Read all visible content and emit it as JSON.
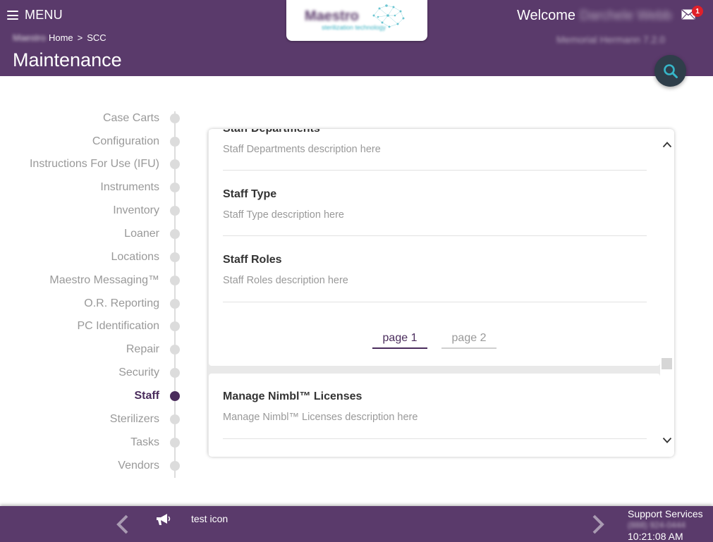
{
  "header": {
    "menu_label": "MENU",
    "breadcrumb": {
      "brand": "Maestro",
      "home": "Home",
      "separator": ">",
      "current": "SCC"
    },
    "page_title": "Maintenance",
    "logo": {
      "name": "Maestro",
      "tagline": "sterilization technology"
    },
    "welcome_label": "Welcome",
    "user_name": "Darchele Webb",
    "notification_count": "1",
    "facility": "Memorial Hermann 7.2.0"
  },
  "sidebar": {
    "items": [
      {
        "label": "Case Carts"
      },
      {
        "label": "Configuration"
      },
      {
        "label": "Instructions For Use (IFU)"
      },
      {
        "label": "Instruments"
      },
      {
        "label": "Inventory"
      },
      {
        "label": "Loaner"
      },
      {
        "label": "Locations"
      },
      {
        "label": "Maestro Messaging™"
      },
      {
        "label": "O.R. Reporting"
      },
      {
        "label": "PC Identification"
      },
      {
        "label": "Repair"
      },
      {
        "label": "Security"
      },
      {
        "label": "Staff"
      },
      {
        "label": "Sterilizers"
      },
      {
        "label": "Tasks"
      },
      {
        "label": "Vendors"
      }
    ],
    "active": "Staff"
  },
  "main": {
    "items": [
      {
        "title": "Staff Departments",
        "description": "Staff Departments description here"
      },
      {
        "title": "Staff Type",
        "description": "Staff Type description here"
      },
      {
        "title": "Staff Roles",
        "description": "Staff Roles description here"
      }
    ],
    "pager": {
      "page1": "page 1",
      "page2": "page 2"
    },
    "section2": {
      "title": "Manage Nimbl™ Licenses",
      "description": "Manage Nimbl™ Licenses description here"
    }
  },
  "footer": {
    "message": "test icon",
    "support_label": "Support Services",
    "support_phone": "(888) 924-0444",
    "time": "10:21:08 AM"
  },
  "colors": {
    "brand": "#5a3a6b",
    "active": "#4a2c5c",
    "badge": "#e0202a",
    "search": "#2f3e4a"
  }
}
